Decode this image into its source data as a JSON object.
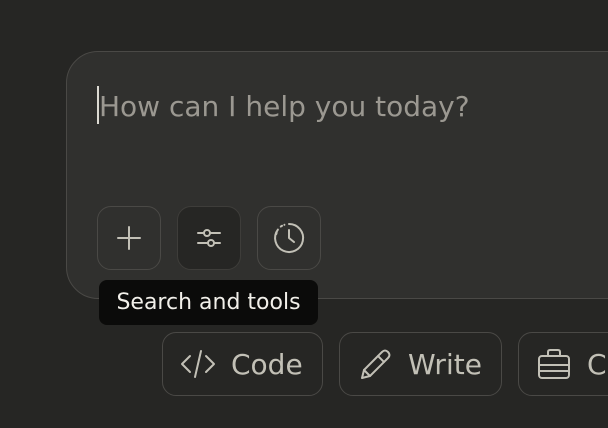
{
  "composer": {
    "placeholder": "How can I help you today?",
    "tools": [
      {
        "icon": "plus-icon"
      },
      {
        "icon": "sliders-icon"
      },
      {
        "icon": "history-clock-icon"
      }
    ],
    "tooltip": "Search and tools"
  },
  "suggestions": [
    {
      "icon": "code-icon",
      "label": "Code"
    },
    {
      "icon": "pencil-icon",
      "label": "Write"
    },
    {
      "icon": "briefcase-icon",
      "label": "C"
    }
  ],
  "colors": {
    "background": "#262624",
    "composer_bg": "#30302e",
    "border": "#4a4946",
    "text": "#c2c0b6",
    "placeholder": "#9b9891",
    "tooltip_bg": "#0b0b0a"
  }
}
